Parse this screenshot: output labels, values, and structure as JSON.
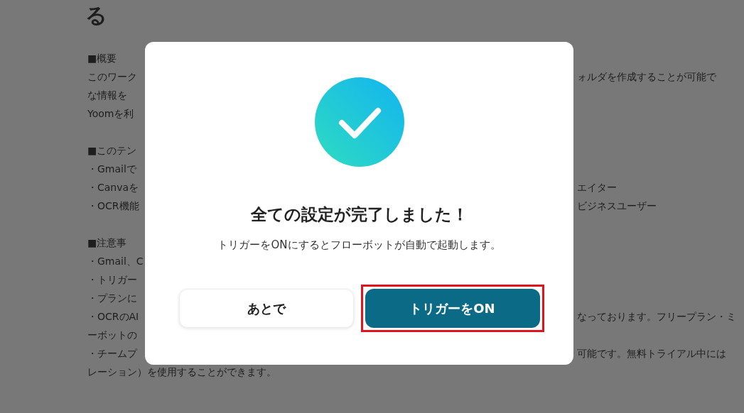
{
  "background": {
    "heading": "る",
    "paragraphs": [
      [
        {
          "left": "■概要"
        },
        {
          "left": "このワーク",
          "right": "ォルダを作成することが可能で"
        },
        {
          "left": "な情報を"
        },
        {
          "left": "Yoomを利"
        }
      ],
      [
        {
          "left": "■このテン"
        },
        {
          "left": "・Gmailで"
        },
        {
          "left": "・Canvaを",
          "right": "エイター"
        },
        {
          "left": "・OCR機能",
          "right": "ビジネスユーザー"
        }
      ],
      [
        {
          "left": "■注意事"
        },
        {
          "left": "・Gmail、C"
        },
        {
          "left": "・トリガー"
        },
        {
          "left": "・プランに"
        },
        {
          "left": "・OCRのAI",
          "right": "なっております。フリープラン・ミ"
        },
        {
          "left": "ーボットの"
        },
        {
          "left": "・チームプ",
          "right": "可能です。無料トライアル中には"
        },
        {
          "left": "レーション）を使用することができます。"
        }
      ]
    ]
  },
  "modal": {
    "title": "全ての設定が完了しました！",
    "message": "トリガーをONにするとフローボットが自動で起動します。",
    "buttons": [
      {
        "label": "あとで",
        "kind": "secondary",
        "highlighted": false
      },
      {
        "label": "トリガーをON",
        "kind": "primary",
        "highlighted": true
      }
    ]
  }
}
